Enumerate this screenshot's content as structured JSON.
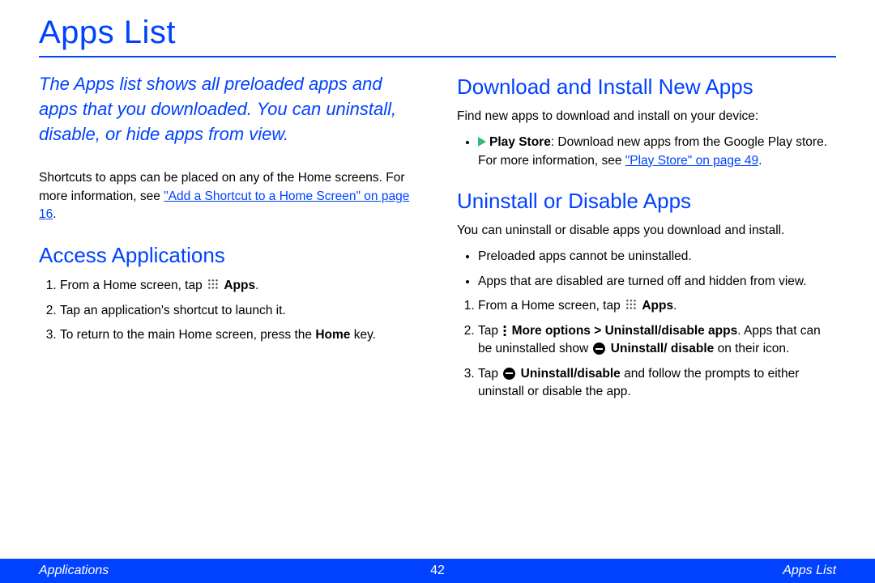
{
  "title": "Apps List",
  "intro": "The Apps list shows all preloaded apps and apps that you downloaded. You can uninstall, disable, or hide apps from view.",
  "left": {
    "shortcuts_para_a": "Shortcuts to apps can be placed on any of the Home screens. For more information, see ",
    "shortcuts_link": "\"Add a Shortcut to a Home Screen\" on page 16",
    "shortcuts_para_b": ".",
    "access_heading": "Access Applications",
    "steps": {
      "s1a": "From a Home screen, tap ",
      "s1b": "Apps",
      "s1c": ".",
      "s2": "Tap an application's shortcut to launch it.",
      "s3a": "To return to the main Home screen, press the ",
      "s3b": "Home",
      "s3c": " key."
    }
  },
  "right": {
    "download_heading": "Download and Install New Apps",
    "download_intro": "Find new apps to download and install on your device:",
    "play_bold": "Play Store",
    "play_text": ": Download new apps from the Google Play store. For more information, see ",
    "play_link": "\"Play Store\" on page 49",
    "play_tail": ".",
    "uninstall_heading": "Uninstall or Disable Apps",
    "uninstall_intro": "You can uninstall or disable apps you download and install.",
    "bullets": {
      "b1": "Preloaded apps cannot be uninstalled.",
      "b2": "Apps that are disabled are turned off and hidden from view."
    },
    "steps": {
      "s1a": "From a Home screen, tap ",
      "s1b": "Apps",
      "s1c": ".",
      "s2a": "Tap ",
      "s2b": "More options > Uninstall/disable apps",
      "s2c": ". Apps that can be uninstalled show ",
      "s2d": "Uninstall/ disable",
      "s2e": " on their icon.",
      "s3a": "Tap ",
      "s3b": "Uninstall/disable",
      "s3c": " and follow the prompts to either uninstall or disable the app."
    }
  },
  "footer": {
    "left": "Applications",
    "page": "42",
    "right": "Apps List"
  }
}
